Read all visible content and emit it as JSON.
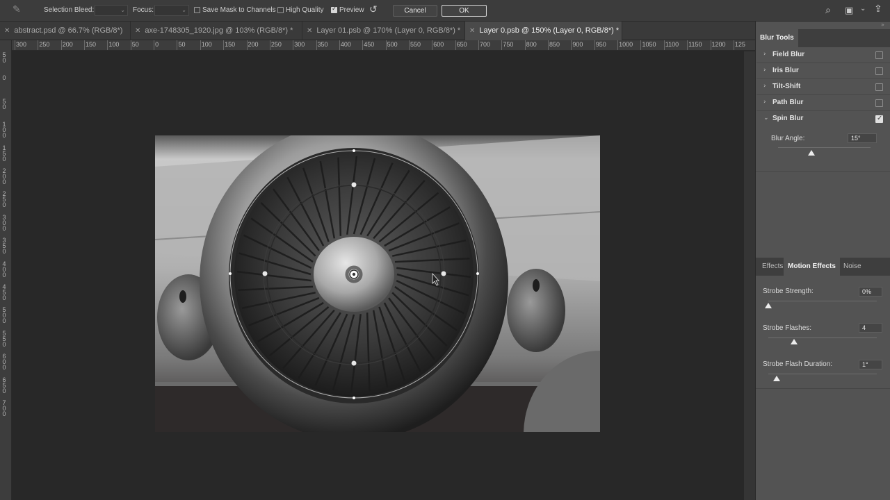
{
  "options_bar": {
    "selection_bleed_label": "Selection Bleed:",
    "focus_label": "Focus:",
    "save_mask_label": "Save Mask to Channels",
    "save_mask_checked": false,
    "high_quality_label": "High Quality",
    "high_quality_checked": false,
    "preview_label": "Preview",
    "preview_checked": true,
    "cancel_label": "Cancel",
    "ok_label": "OK"
  },
  "tabs": [
    {
      "label": "abstract.psd @ 66.7% (RGB/8*)",
      "active": false
    },
    {
      "label": "axe-1748305_1920.jpg @ 103% (RGB/8*) *",
      "active": false
    },
    {
      "label": "Layer 01.psb @ 170% (Layer 0, RGB/8*) *",
      "active": false
    },
    {
      "label": "Layer 0.psb @ 150% (Layer 0, RGB/8*) *",
      "active": true
    }
  ],
  "ruler_top": [
    "300",
    "250",
    "200",
    "150",
    "100",
    "50",
    "0",
    "50",
    "100",
    "150",
    "200",
    "250",
    "300",
    "350",
    "400",
    "450",
    "500",
    "550",
    "600",
    "650",
    "700",
    "750",
    "800",
    "850",
    "900",
    "950",
    "1000",
    "1050",
    "1100",
    "1150",
    "1200",
    "125"
  ],
  "ruler_left": [
    "50",
    "0",
    "50",
    "100",
    "150",
    "200",
    "250",
    "300",
    "350",
    "400",
    "450",
    "500",
    "550",
    "600",
    "650",
    "700"
  ],
  "panel": {
    "title": "Blur Tools",
    "blur_tools": [
      {
        "name": "Field Blur",
        "checked": false,
        "expanded": false
      },
      {
        "name": "Iris Blur",
        "checked": false,
        "expanded": false
      },
      {
        "name": "Tilt-Shift",
        "checked": false,
        "expanded": false
      },
      {
        "name": "Path Blur",
        "checked": false,
        "expanded": false
      },
      {
        "name": "Spin Blur",
        "checked": true,
        "expanded": true
      }
    ],
    "blur_angle_label": "Blur Angle:",
    "blur_angle_value": "15°",
    "blur_angle_fraction": 0.36,
    "effects_tabs": [
      "Effects",
      "Motion Effects",
      "Noise"
    ],
    "active_effects_tab": "Motion Effects",
    "strobe_strength_label": "Strobe Strength:",
    "strobe_strength_value": "0%",
    "strobe_strength_fraction": 0.0,
    "strobe_flashes_label": "Strobe Flashes:",
    "strobe_flashes_value": "4",
    "strobe_flashes_fraction": 0.24,
    "strobe_flash_duration_label": "Strobe Flash Duration:",
    "strobe_flash_duration_value": "1°",
    "strobe_flash_duration_fraction": 0.08
  },
  "colors": {
    "app_background": "#282828",
    "panel_background": "#535353",
    "toolbar_background": "#3c3c3c"
  }
}
